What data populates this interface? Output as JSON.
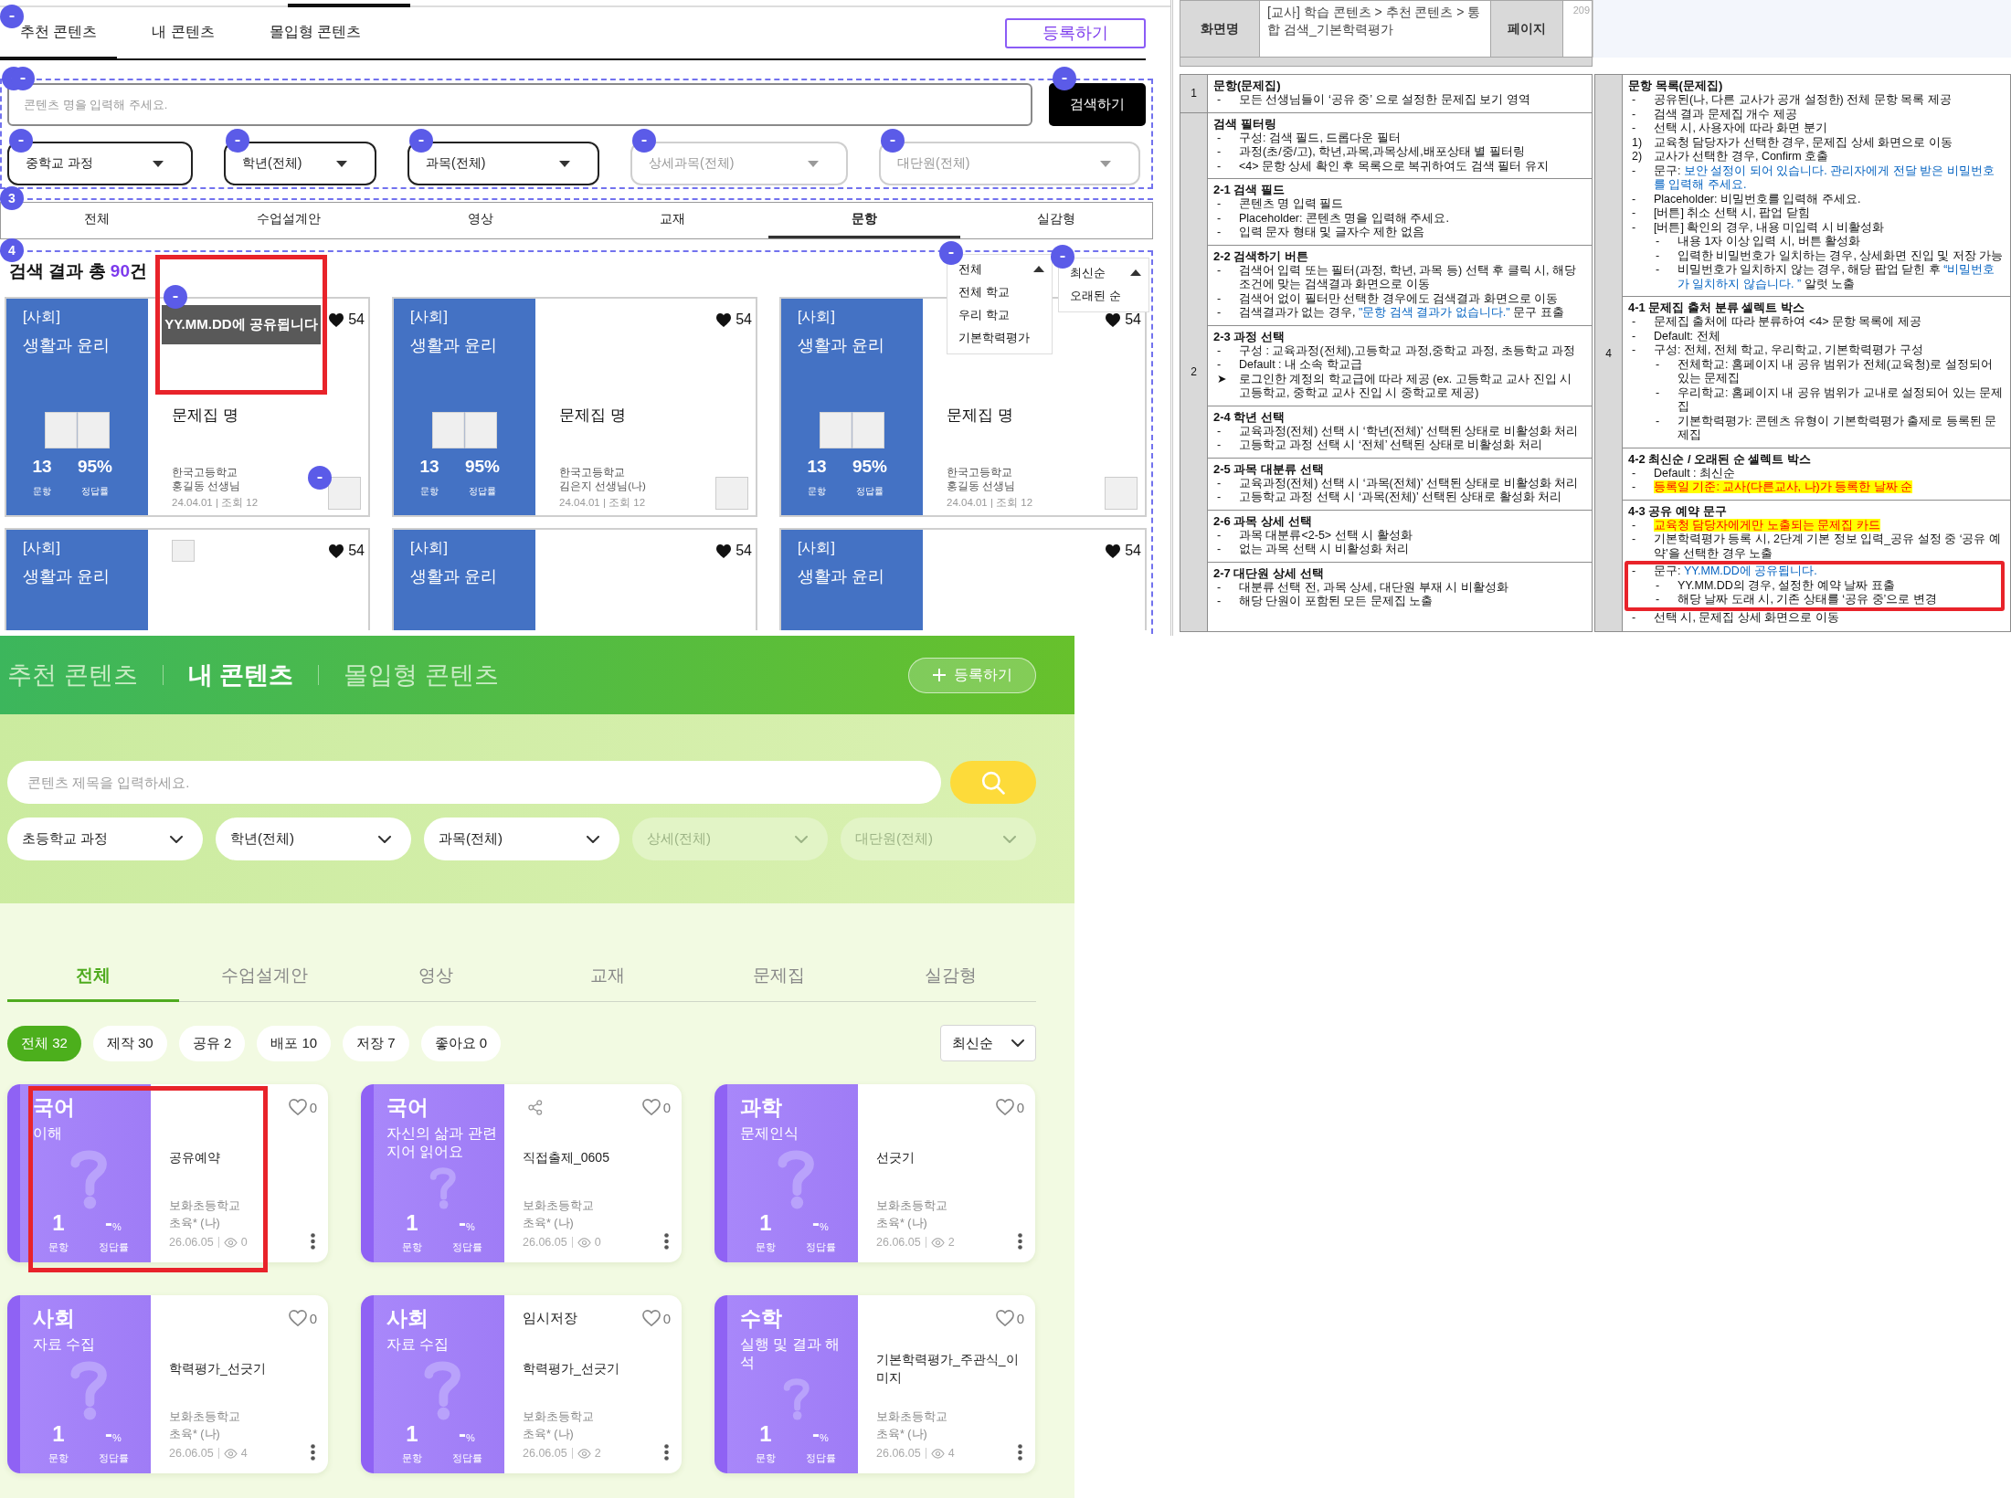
{
  "wireframe": {
    "header": {
      "annotated": true,
      "tabs": [
        {
          "label": "추천 콘텐츠",
          "selected": true
        },
        {
          "label": "내 콘텐츠",
          "selected": false
        },
        {
          "label": "몰입형 콘텐츠",
          "selected": false
        }
      ],
      "register_button": "등록하기"
    },
    "search_section": {
      "annotated": true,
      "search_field": {
        "placeholder": "콘텐츠 명을 입력해 주세요.",
        "annotated": true
      },
      "search_button": {
        "label": "검색하기",
        "annotated": true
      },
      "filters": [
        {
          "label": "중학교 과정",
          "disabled": false,
          "annotated": true
        },
        {
          "label": "학년(전체)",
          "disabled": false,
          "annotated": true
        },
        {
          "label": "과목(전체)",
          "disabled": false,
          "annotated": true
        },
        {
          "label": "상세과목(전체)",
          "disabled": true,
          "annotated": true
        },
        {
          "label": "대단원(전체)",
          "disabled": true,
          "annotated": true
        }
      ]
    },
    "type_tabs": {
      "annotation": "3",
      "tabs": [
        {
          "label": "전체",
          "selected": false
        },
        {
          "label": "수업설계안",
          "selected": false
        },
        {
          "label": "영상",
          "selected": false
        },
        {
          "label": "교재",
          "selected": false
        },
        {
          "label": "문항",
          "selected": true
        },
        {
          "label": "실감형",
          "selected": false
        }
      ]
    },
    "results": {
      "annotation": "4",
      "heading": {
        "prefix": "검색 결과 총 ",
        "count": "90",
        "suffix": "건"
      },
      "source_menu": {
        "annotated": true,
        "value": "전체",
        "options": [
          "전체 학교",
          "우리 학교",
          "기본학력평가"
        ]
      },
      "sort_menu": {
        "annotated": true,
        "value": "최신순",
        "options": [
          "오래된 순"
        ]
      },
      "cards": [
        {
          "subject": "[사회]",
          "unit": "생활과 윤리",
          "count": "13",
          "count_label": "문항",
          "rate": "95%",
          "rate_label": "정답률",
          "likes": "54",
          "title": "문제집 명",
          "school": "한국고등학교",
          "teacher": "홍길동 선생님",
          "meta": "24.04.01 | 조회 12",
          "thumbnail": true,
          "thumbnail_annotated": true,
          "tooltip": {
            "text": "YY.MM.DD에 공유됩니다",
            "annotated": true
          },
          "highlighted": true
        },
        {
          "subject": "[사회]",
          "unit": "생활과 윤리",
          "count": "13",
          "count_label": "문항",
          "rate": "95%",
          "rate_label": "정답률",
          "likes": "54",
          "title": "문제집 명",
          "school": "한국고등학교",
          "teacher": "김은지 선생님(나)",
          "meta": "24.04.01 | 조회 12",
          "thumbnail": true,
          "thumbnail_annotated": false,
          "highlighted": false
        },
        {
          "subject": "[사회]",
          "unit": "생활과 윤리",
          "count": "13",
          "count_label": "문항",
          "rate": "95%",
          "rate_label": "정답률",
          "likes": "54",
          "title": "문제집 명",
          "school": "한국고등학교",
          "teacher": "홍길동 선생님",
          "meta": "24.04.01 | 조회 12",
          "thumbnail": true,
          "thumbnail_annotated": false,
          "highlighted": false
        },
        {
          "subject": "[사회]",
          "unit": "생활과 윤리",
          "likes": "54",
          "thumbnail": true,
          "thumbnail_annotated": false,
          "highlighted": false
        },
        {
          "subject": "[사회]",
          "unit": "생활과 윤리",
          "likes": "54",
          "thumbnail": false,
          "highlighted": false
        },
        {
          "subject": "[사회]",
          "unit": "생활과 윤리",
          "likes": "54",
          "thumbnail": false,
          "highlighted": false
        }
      ]
    }
  },
  "spec": {
    "header": {
      "screen_label": "화면명",
      "screen_name": "[교사] 학습 콘텐츠 > 추천 콘텐츠 > 통합 검색_기본학력평가",
      "page_label": "페이지",
      "page_number": "209"
    },
    "left_rows": [
      {
        "number": "1",
        "blocks": [
          {
            "title": "문항(문제집)",
            "items": [
              {
                "marker": "-",
                "text": "모든 선생님들이 ‘공유 중’ 으로 설정한 문제집 보기 영역"
              }
            ]
          }
        ]
      },
      {
        "number": "2",
        "blocks": [
          {
            "title": "검색 필터링",
            "items": [
              {
                "marker": "-",
                "text": "구성: 검색 필드, 드롭다운 필터"
              },
              {
                "marker": "-",
                "text": "과정(초/중/고), 학년,과목,과목상세,배포상태 별 필터링"
              },
              {
                "marker": "-",
                "text": "<4> 문항 상세 확인 후 목록으로 복귀하여도 검색 필터 유지"
              }
            ]
          },
          {
            "title": "2-1 검색 필드",
            "items": [
              {
                "marker": "-",
                "text": "콘텐츠 명 입력 필드"
              },
              {
                "marker": "-",
                "text": "Placeholder: 콘텐츠 명을 입력해 주세요."
              },
              {
                "marker": "-",
                "text": "입력 문자 형태 및 글자수 제한 없음"
              }
            ]
          },
          {
            "title": "2-2 검색하기 버튼",
            "items": [
              {
                "marker": "-",
                "text": "검색어 입력 또는 필터(과정, 학년, 과목 등) 선택 후 클릭 시, 해당 조건에 맞는 검색결과 화면으로 이동"
              },
              {
                "marker": "-",
                "text": "검색어 없이 필터만 선택한 경우에도 검색결과 화면으로 이동"
              },
              {
                "marker": "-",
                "segments": [
                  {
                    "text": "검색결과가 없는 경우, ",
                    "kind": "plain"
                  },
                  {
                    "text": "\"문항 검색 결과가 없습니다.\"",
                    "kind": "accent"
                  },
                  {
                    "text": " 문구 표출",
                    "kind": "plain"
                  }
                ]
              }
            ]
          },
          {
            "title": "2-3 과정 선택",
            "items": [
              {
                "marker": "-",
                "text": "구성 : 교육과정(전체),고등학교 과정,중학교 과정, 초등학교 과정"
              },
              {
                "marker": "-",
                "text": "Default : 내 소속 학교급"
              },
              {
                "marker": "➤",
                "text": "로그인한 계정의 학교급에 따라 제공 (ex. 고등학교 교사 진입 시 고등학교, 중학교 교사 진입 시 중학교로 제공)"
              }
            ]
          },
          {
            "title": "2-4 학년 선택",
            "items": [
              {
                "marker": "-",
                "text": "교육과정(전체) 선택 시 ‘학년(전체)’ 선택된 상태로 비활성화 처리"
              },
              {
                "marker": "-",
                "text": "고등학교 과정 선택 시 ‘전체’ 선택된 상태로 비활성화 처리"
              }
            ]
          },
          {
            "title": "2-5 과목 대분류 선택",
            "items": [
              {
                "marker": "-",
                "text": "교육과정(전체) 선택 시 ‘과목(전체)’ 선택된 상태로 비활성화 처리"
              },
              {
                "marker": "-",
                "text": "고등학교 과정 선택 시 ‘과목(전체)’ 선택된 상태로 활성화 처리"
              }
            ]
          },
          {
            "title": "2-6 과목 상세 선택",
            "items": [
              {
                "marker": "-",
                "text": "과목 대분류<2-5> 선택 시 활성화"
              },
              {
                "marker": "-",
                "text": "없는 과목 선택 시 비활성화 처리"
              }
            ]
          },
          {
            "title": "2-7 대단원 상세 선택",
            "items": [
              {
                "marker": "-",
                "text": "대분류 선택 전, 과목 상세, 대단원 부재 시 비활성화"
              },
              {
                "marker": "-",
                "text": "해당 단원이 포함된 모든 문제집 노출"
              }
            ]
          }
        ]
      }
    ],
    "right_rows": [
      {
        "number": "4",
        "blocks": [
          {
            "title": "문항 목록(문제집)",
            "items": [
              {
                "marker": "-",
                "text": "공유된(나, 다른 교사가 공개 설정한) 전체 문항 목록 제공"
              },
              {
                "marker": "-",
                "text": "검색 결과 문제집 개수 제공"
              },
              {
                "marker": "-",
                "text": "선택 시, 사용자에 따라 화면 분기"
              },
              {
                "marker": "1)",
                "text": "교육청 담당자가 선택한 경우, 문제집 상세 화면으로 이동"
              },
              {
                "marker": "2)",
                "text": "교사가 선택한 경우, Confirm 호출"
              },
              {
                "marker": "-",
                "segments": [
                  {
                    "text": "문구: ",
                    "kind": "plain"
                  },
                  {
                    "text": "보안 설정이 되어 있습니다. 관리자에게 전달 받은 비밀번호를 입력해 주세요.",
                    "kind": "accent"
                  }
                ]
              },
              {
                "marker": "-",
                "text": "Placeholder: 비밀번호를 입력해 주세요."
              },
              {
                "marker": "-",
                "text": "[버튼] 취소 선택 시, 팝업 닫힘"
              },
              {
                "marker": "-",
                "text": "[버튼] 확인의 경우, 내용 미입력 시 비활성화",
                "children": [
                  {
                    "marker": "-",
                    "text": "내용 1자 이상 입력 시, 버튼 활성화"
                  },
                  {
                    "marker": "-",
                    "text": "입력한 비밀번호가 일치하는 경우, 상세화면 진입 및 저장 가능"
                  },
                  {
                    "marker": "-",
                    "segments": [
                      {
                        "text": "비밀번호가 일치하지 않는 경우, 해당 팝업 닫힌 후 ",
                        "kind": "plain"
                      },
                      {
                        "text": "“비밀번호가 일치하지 않습니다. ”",
                        "kind": "accent"
                      },
                      {
                        "text": " 알럿 노출",
                        "kind": "plain"
                      }
                    ]
                  }
                ]
              }
            ]
          },
          {
            "title": "4-1 문제집 출처 분류 셀렉트 박스",
            "items": [
              {
                "marker": "-",
                "text": "문제집 출처에 따라 분류하여 <4> 문항 목록에 제공"
              },
              {
                "marker": "-",
                "text": "Default: 전체"
              },
              {
                "marker": "-",
                "text": "구성: 전체, 전체 학교, 우리학교, 기본학력평가 구성",
                "children": [
                  {
                    "marker": "-",
                    "text": "전체학교: 홈페이지 내 공유 범위가 전체(교육청)로 설정되어 있는 문제집"
                  },
                  {
                    "marker": "-",
                    "text": "우리학교: 홈페이지 내 공유 범위가 교내로 설정되어 있는 문제집"
                  },
                  {
                    "marker": "-",
                    "text": "기본학력평가: 콘텐츠 유형이 기본학력평가 출제로 등록된 문제집"
                  }
                ]
              }
            ]
          },
          {
            "title": "4-2 최신순 / 오래된 순 셀렉트 박스",
            "items": [
              {
                "marker": "-",
                "text": "Default : 최신순"
              },
              {
                "marker": "-",
                "segments": [
                  {
                    "text": "등록일 기준: 교사(다른교사, 나)가 등록한 날짜 순",
                    "kind": "alert"
                  }
                ]
              }
            ]
          },
          {
            "title": "4-3 공유 예약 문구",
            "items": [
              {
                "marker": "-",
                "segments": [
                  {
                    "text": "교육청 담당자에게만 노출되는 문제집 카드",
                    "kind": "alert"
                  }
                ],
                "highlighted": false
              },
              {
                "marker": "-",
                "text": "기본학력평가 등록 시, 2단계 기본 정보 입력_공유 설정 중 ‘공유 예약’을 선택한 경우 노출",
                "highlighted": false
              },
              {
                "marker": "-",
                "segments": [
                  {
                    "text": "문구: ",
                    "kind": "plain"
                  },
                  {
                    "text": "YY.MM.DD에 공유됩니다.",
                    "kind": "accent"
                  }
                ],
                "highlighted": true,
                "children": [
                  {
                    "marker": "-",
                    "text": "YY.MM.DD의 경우, 설정한 예약 날짜 표출"
                  },
                  {
                    "marker": "-",
                    "text": "해당 날짜 도래 시, 기존 상태를 ‘공유 중’으로 변경"
                  }
                ]
              },
              {
                "marker": "-",
                "text": "선택 시, 문제집 상세 화면으로 이동",
                "highlighted": false
              }
            ]
          }
        ]
      }
    ]
  },
  "app": {
    "nav": [
      {
        "label": "추천 콘텐츠",
        "selected": false
      },
      {
        "label": "내 콘텐츠",
        "selected": true
      },
      {
        "label": "몰입형 콘텐츠",
        "selected": false
      }
    ],
    "register_button": "등록하기",
    "search": {
      "placeholder": "콘텐츠 제목을 입력하세요."
    },
    "filters": [
      {
        "label": "초등학교 과정",
        "disabled": false
      },
      {
        "label": "학년(전체)",
        "disabled": false
      },
      {
        "label": "과목(전체)",
        "disabled": false
      },
      {
        "label": "상세(전체)",
        "disabled": true
      },
      {
        "label": "대단원(전체)",
        "disabled": true
      }
    ],
    "tabs": [
      {
        "label": "전체",
        "selected": true
      },
      {
        "label": "수업설계안",
        "selected": false
      },
      {
        "label": "영상",
        "selected": false
      },
      {
        "label": "교재",
        "selected": false
      },
      {
        "label": "문제집",
        "selected": false
      },
      {
        "label": "실감형",
        "selected": false
      }
    ],
    "chips": [
      {
        "label": "전체 32",
        "selected": true
      },
      {
        "label": "제작 30",
        "selected": false
      },
      {
        "label": "공유 2",
        "selected": false
      },
      {
        "label": "배포 10",
        "selected": false
      },
      {
        "label": "저장 7",
        "selected": false
      },
      {
        "label": "좋아요 0",
        "selected": false
      }
    ],
    "sort": "최신순",
    "cards": [
      {
        "subject": "국어",
        "unit": "이해",
        "count": "1",
        "count_label": "문항",
        "rate": "-",
        "rate_unit": "%",
        "rate_label": "정답률",
        "likes": "0",
        "shareable": false,
        "title": "공유예약",
        "school": "보화초등학교",
        "teacher": "초육* (나)",
        "date": "26.06.05",
        "views": "0",
        "highlighted": true
      },
      {
        "subject": "국어",
        "unit": "자신의 삶과 관련지어 읽어요",
        "count": "1",
        "count_label": "문항",
        "rate": "-",
        "rate_unit": "%",
        "rate_label": "정답률",
        "likes": "0",
        "shareable": true,
        "title": "직접출제_0605",
        "school": "보화초등학교",
        "teacher": "초육* (나)",
        "date": "26.06.05",
        "views": "0",
        "highlighted": false
      },
      {
        "subject": "과학",
        "unit": "문제인식",
        "count": "1",
        "count_label": "문항",
        "rate": "-",
        "rate_unit": "%",
        "rate_label": "정답률",
        "likes": "0",
        "shareable": false,
        "title": "선긋기",
        "school": "보화초등학교",
        "teacher": "초육* (나)",
        "date": "26.06.05",
        "views": "2",
        "highlighted": false
      },
      {
        "subject": "사회",
        "unit": "자료 수집",
        "count": "1",
        "count_label": "문항",
        "rate": "-",
        "rate_unit": "%",
        "rate_label": "정답률",
        "likes": "0",
        "shareable": false,
        "title": "학력평가_선긋기",
        "school": "보화초등학교",
        "teacher": "초육* (나)",
        "date": "26.06.05",
        "views": "4",
        "highlighted": false
      },
      {
        "subject": "사회",
        "unit": "자료 수집",
        "count": "1",
        "count_label": "문항",
        "rate": "-",
        "rate_unit": "%",
        "rate_label": "정답률",
        "likes": "0",
        "shareable": false,
        "status": "임시저장",
        "title": "학력평가_선긋기",
        "school": "보화초등학교",
        "teacher": "초육* (나)",
        "date": "26.06.05",
        "views": "2",
        "highlighted": false
      },
      {
        "subject": "수학",
        "unit": "실행 및 결과 해석",
        "count": "1",
        "count_label": "문항",
        "rate": "-",
        "rate_unit": "%",
        "rate_label": "정답률",
        "likes": "0",
        "shareable": false,
        "title": "기본학력평가_주관식_이미지",
        "school": "보화초등학교",
        "teacher": "초육* (나)",
        "date": "26.06.05",
        "views": "4",
        "highlighted": false
      }
    ]
  }
}
